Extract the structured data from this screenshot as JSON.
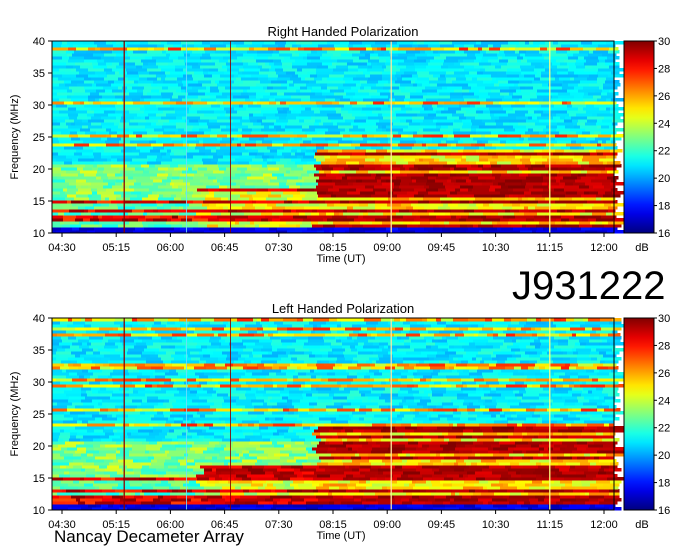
{
  "observation_id": "J931222",
  "observatory": "Nancay Decameter Array",
  "chart_data": [
    {
      "type": "heatmap",
      "title": "Right Handed Polarization",
      "xlabel": "Time (UT)",
      "ylabel": "Frequency (MHz)",
      "x_ticks": [
        "04:30",
        "05:15",
        "06:00",
        "06:45",
        "07:30",
        "08:15",
        "09:00",
        "09:45",
        "10:30",
        "11:15",
        "12:00"
      ],
      "y_ticks": [
        "10",
        "15",
        "20",
        "25",
        "30",
        "35",
        "40"
      ],
      "ylim": [
        10,
        40
      ],
      "colorbar": {
        "label": "dB",
        "range": [
          16,
          30
        ],
        "ticks": [
          "16",
          "18",
          "20",
          "22",
          "24",
          "26",
          "28",
          "30"
        ]
      }
    },
    {
      "type": "heatmap",
      "title": "Left Handed Polarization",
      "xlabel": "Time (UT)",
      "ylabel": "Frequency (MHz)",
      "x_ticks": [
        "04:30",
        "05:15",
        "06:00",
        "06:45",
        "07:30",
        "08:15",
        "09:00",
        "09:45",
        "10:30",
        "11:15",
        "12:00"
      ],
      "y_ticks": [
        "10",
        "15",
        "20",
        "25",
        "30",
        "35",
        "40"
      ],
      "ylim": [
        10,
        40
      ],
      "colorbar": {
        "label": "dB",
        "range": [
          16,
          30
        ],
        "ticks": [
          "16",
          "18",
          "20",
          "22",
          "24",
          "26",
          "28",
          "30"
        ]
      }
    }
  ]
}
